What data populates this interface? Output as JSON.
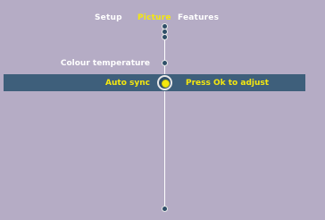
{
  "tabs": [
    {
      "label": "Setup",
      "active": false
    },
    {
      "label": "Picture",
      "active": true
    },
    {
      "label": "Features",
      "active": false
    }
  ],
  "menu": {
    "items": [
      {
        "label": "Colour temperature",
        "selected": false
      },
      {
        "label": "Auto sync",
        "selected": true
      }
    ],
    "hint": "Press Ok to adjust"
  },
  "colors": {
    "background": "#b5acc5",
    "highlight_row": "#3e5f7b",
    "active_text": "#f5e80f",
    "text": "#ffffff"
  },
  "icons": {
    "slider_knob": "circle-knob-icon",
    "selected_knob": "selected-knob-icon"
  }
}
